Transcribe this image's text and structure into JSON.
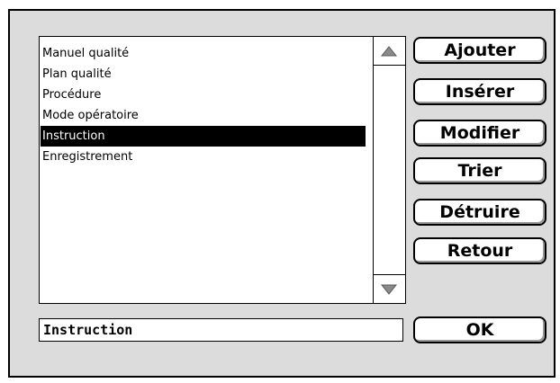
{
  "list": {
    "items": [
      {
        "label": "Manuel qualité",
        "selected": false
      },
      {
        "label": "Plan qualité",
        "selected": false
      },
      {
        "label": "Procédure",
        "selected": false
      },
      {
        "label": "Mode opératoire",
        "selected": false
      },
      {
        "label": "Instruction",
        "selected": true
      },
      {
        "label": "Enregistrement",
        "selected": false
      }
    ]
  },
  "buttons": {
    "add": "Ajouter",
    "insert": "Insérer",
    "modify": "Modifier",
    "sort": "Trier",
    "delete": "Détruire",
    "back": "Retour",
    "ok": "OK"
  },
  "name_field": {
    "value": "Instruction"
  },
  "icons": {
    "scroll_up": "triangle-up-icon",
    "scroll_down": "triangle-down-icon"
  }
}
